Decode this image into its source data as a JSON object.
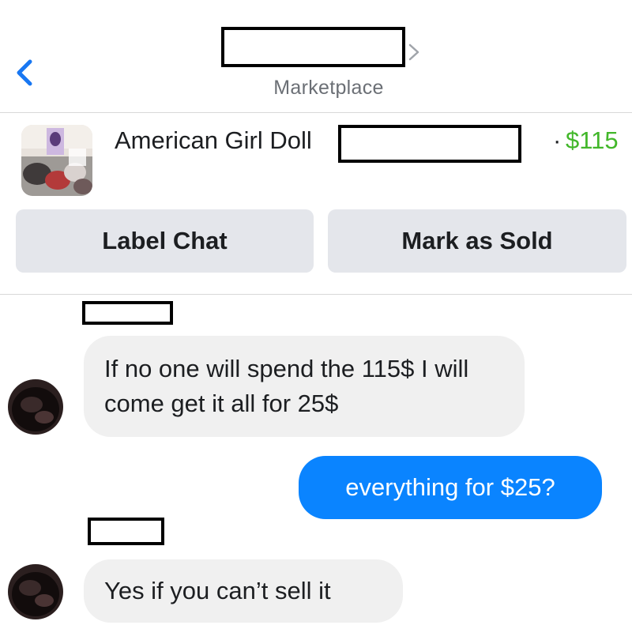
{
  "header": {
    "title": "",
    "subtitle": "Marketplace"
  },
  "listing": {
    "title": "American Girl Doll",
    "separator": "·",
    "price": "$115",
    "price_color": "#42b72a"
  },
  "actions": {
    "label_chat": "Label Chat",
    "mark_as_sold": "Mark as Sold"
  },
  "messages": [
    {
      "direction": "incoming",
      "text": "If no one will spend the 115$ I will come get it all for 25$"
    },
    {
      "direction": "outgoing",
      "text": "everything for $25?"
    },
    {
      "direction": "incoming",
      "text": "Yes if you can’t sell it"
    }
  ],
  "colors": {
    "accent_blue": "#0a84ff",
    "bubble_gray": "#f0f0f0",
    "button_gray": "#e4e6eb"
  }
}
